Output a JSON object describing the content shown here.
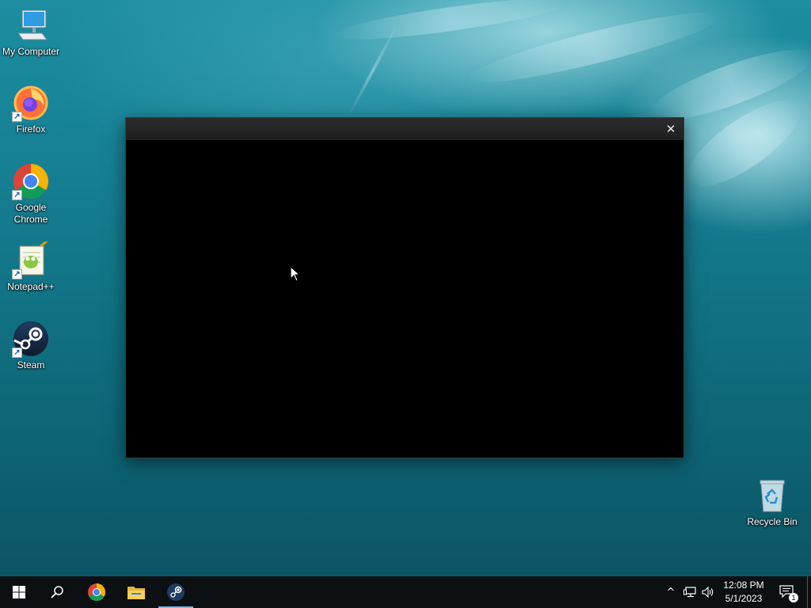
{
  "desktop": {
    "icons": [
      {
        "label": "My Computer",
        "icon": "my-computer-icon"
      },
      {
        "label": "Firefox",
        "icon": "firefox-icon"
      },
      {
        "label": "Google\nChrome",
        "icon": "chrome-icon"
      },
      {
        "label": "Notepad++",
        "icon": "notepad-plus-plus-icon"
      },
      {
        "label": "Steam",
        "icon": "steam-icon"
      },
      {
        "label": "Recycle Bin",
        "icon": "recycle-bin-icon"
      }
    ]
  },
  "window": {
    "title": "",
    "close_glyph": "✕"
  },
  "taskbar": {
    "pinned": [
      {
        "name": "start-button",
        "icon": "windows-logo-icon"
      },
      {
        "name": "search-button",
        "icon": "search-icon"
      },
      {
        "name": "chrome-taskbar-button",
        "icon": "chrome-icon"
      },
      {
        "name": "file-explorer-taskbar-button",
        "icon": "folder-icon"
      },
      {
        "name": "steam-taskbar-button",
        "icon": "steam-icon",
        "active": true
      }
    ],
    "tray": {
      "show_hidden_glyph": "^",
      "time": "12:08 PM",
      "date": "5/1/2023",
      "notification_count": "1"
    }
  },
  "colors": {
    "taskbar_bg": "#0d1012",
    "active_indicator": "#76b9ed",
    "window_bg": "#000000",
    "titlebar_bg": "#252525"
  }
}
